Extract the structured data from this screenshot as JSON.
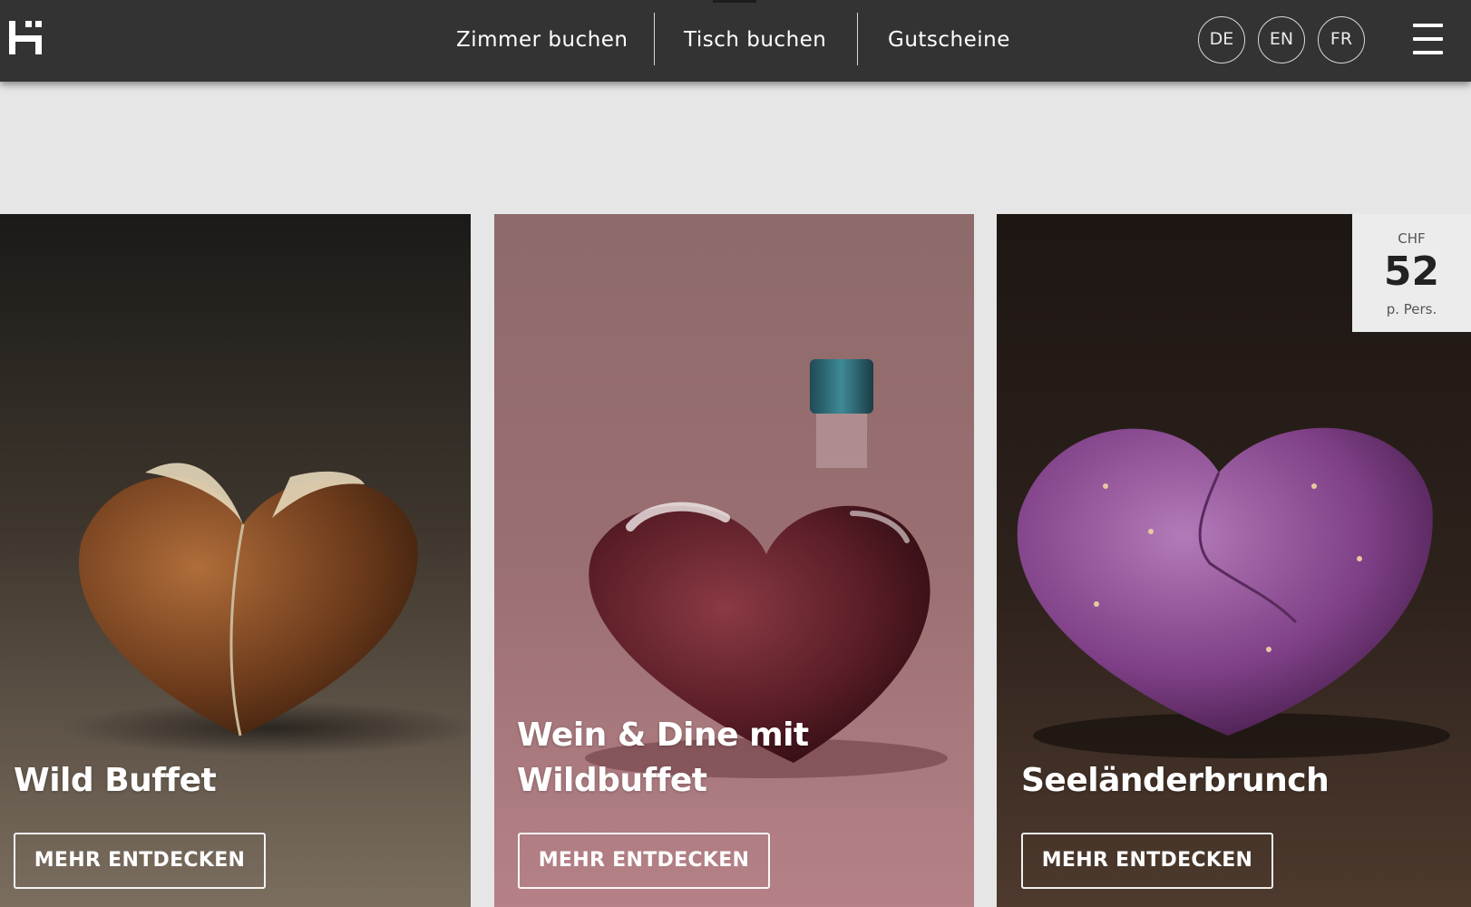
{
  "header": {
    "logo_alt": "Hotel logo",
    "nav": [
      "Zimmer buchen",
      "Tisch buchen",
      "Gutscheine"
    ],
    "languages": [
      "DE",
      "EN",
      "FR"
    ],
    "menu_icon": "hamburger-menu-icon"
  },
  "cards": [
    {
      "title": "Wild Buffet",
      "button": "MEHR ENTDECKEN",
      "image": "chestnut-heart"
    },
    {
      "title": "Wein & Dine mit Wildbuffet",
      "button": "MEHR ENTDECKEN",
      "image": "heart-shaped-wine-bottle"
    },
    {
      "title": "Seeländerbrunch",
      "button": "MEHR ENTDECKEN",
      "image": "purple-potato-heart",
      "price": {
        "currency": "CHF",
        "value": "52",
        "unit": "p. Pers."
      }
    }
  ],
  "colors": {
    "header_bg": "#333333",
    "page_bg": "#e6e6e6",
    "card1_bg": "#4a4036",
    "card2_bg": "#9c6d70",
    "card3_bg": "#2f221c"
  }
}
